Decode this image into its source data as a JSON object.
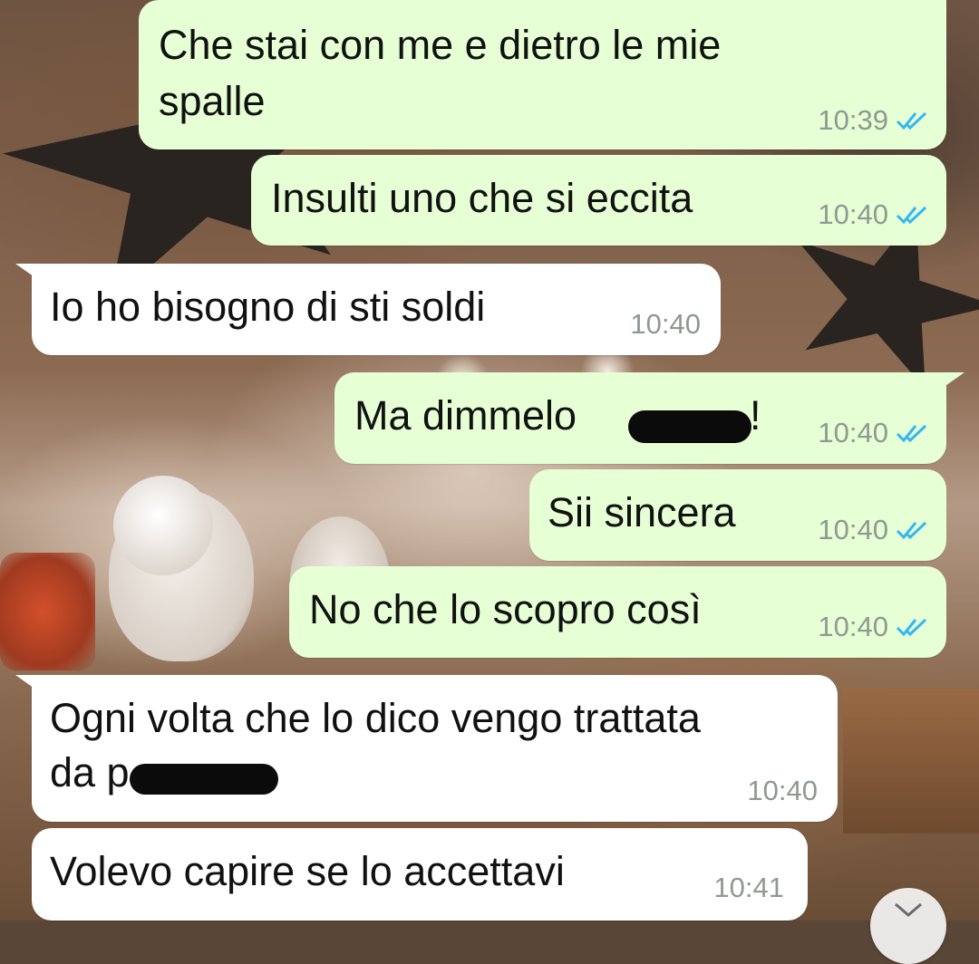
{
  "chat": {
    "messages": [
      {
        "direction": "outgoing",
        "lines": [
          "Che stai con me e dietro le mie",
          "spalle"
        ],
        "time": "10:39",
        "status": "read"
      },
      {
        "direction": "outgoing",
        "lines": [
          "Insulti uno che si eccita"
        ],
        "time": "10:40",
        "status": "read"
      },
      {
        "direction": "incoming",
        "lines": [
          "Io ho bisogno di sti soldi"
        ],
        "time": "10:40"
      },
      {
        "direction": "outgoing",
        "lines": [
          "Ma dimmelo",
          "!"
        ],
        "redacted": true,
        "time": "10:40",
        "status": "read"
      },
      {
        "direction": "outgoing",
        "lines": [
          "Sii sincera"
        ],
        "time": "10:40",
        "status": "read"
      },
      {
        "direction": "outgoing",
        "lines": [
          "No che lo scopro così"
        ],
        "time": "10:40",
        "status": "read"
      },
      {
        "direction": "incoming",
        "lines": [
          "Ogni volta che lo dico vengo trattata",
          "da p"
        ],
        "redacted": true,
        "time": "10:40"
      },
      {
        "direction": "incoming",
        "lines": [
          "Volevo capire se lo accettavi"
        ],
        "time": "10:41"
      }
    ]
  },
  "colors": {
    "outgoing_bubble": "#e6ffd5",
    "incoming_bubble": "#ffffff",
    "read_ticks": "#34b7f1",
    "timestamp": "#8f9993"
  },
  "icons": {
    "read_receipt": "double-check-icon",
    "scroll_down": "chevron-down-icon"
  }
}
